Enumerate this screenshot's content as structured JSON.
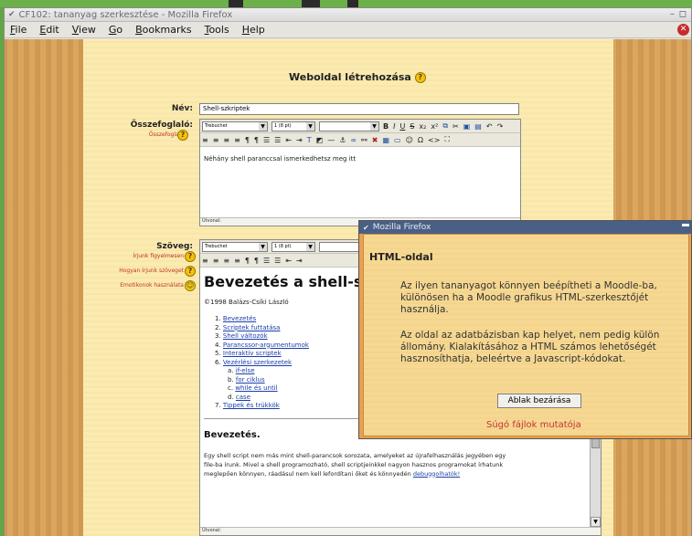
{
  "window": {
    "title": "CF102: tananyag szerkesztése - Mozilla Firefox",
    "menu": [
      "File",
      "Edit",
      "View",
      "Go",
      "Bookmarks",
      "Tools",
      "Help"
    ]
  },
  "form": {
    "title": "Weboldal létrehozása",
    "name_label": "Név:",
    "name_value": "Shell-szkriptek",
    "summary_label": "Összefoglaló:",
    "summary_help_link": "Összefoglaló",
    "summary_text": "Néhány shell paranccsal ismerkedhetsz meg itt",
    "path_label": "Útvonal:",
    "content_label": "Szöveg:",
    "content_links": [
      "Írjunk figyelmesen",
      "Hogyan írjunk szöveget",
      "Emotikonok használata"
    ]
  },
  "toolbar": {
    "font": "Trebuchet",
    "size": "1 (8 pt)",
    "style": ""
  },
  "doc": {
    "heading": "Bevezetés a shell-sc",
    "author": "©1998 Balázs-Csíki László",
    "toc": [
      {
        "n": "1.",
        "t": "Bevezetés"
      },
      {
        "n": "2.",
        "t": "Scriptek futtatása"
      },
      {
        "n": "3.",
        "t": "Shell változók"
      },
      {
        "n": "4.",
        "t": "Parancssor-argumentumok"
      },
      {
        "n": "5.",
        "t": "Interaktív scriptek"
      },
      {
        "n": "6.",
        "t": "Vezérlési szerkezetek"
      },
      {
        "n": "a.",
        "t": "if-else"
      },
      {
        "n": "b.",
        "t": "for ciklus"
      },
      {
        "n": "c.",
        "t": "while és until"
      },
      {
        "n": "d.",
        "t": "case"
      },
      {
        "n": "7.",
        "t": "Tippek és trükkök"
      }
    ],
    "section": "Bevezetés.",
    "para_1": "Egy shell script nem más mint shell-parancsok sorozata, amelyeket az újrafelhasználás jegyében egy",
    "para_2": "file-ba írunk. Mivel a shell programozható, shell scriptjeinkkel nagyon hasznos programokat írhatunk",
    "para_3": "meglepően könnyen, ráadásul nem kell lefordítani őket és könnyedén ",
    "para_link": "debuggolhatók!"
  },
  "popup": {
    "title": "Mozilla Firefox",
    "heading": "HTML-oldal",
    "p1_l1": "Az ilyen tananyagot könnyen beépítheti a Moodle-ba,",
    "p1_l2": "különösen ha a Moodle grafikus HTML-szerkesztőjét",
    "p1_l3": "használja.",
    "p2_l1": "Az oldal az adatbázisban kap helyet, nem pedig külön",
    "p2_l2": "állomány. Kialakításához a HTML számos lehetőségét",
    "p2_l3": "hasznosíthatja, beleértve a Javascript-kódokat.",
    "close_button": "Ablak bezárása",
    "help_files_link": "Súgó fájlok mutatója"
  },
  "colors": {
    "desktop": "#62a544",
    "page_bg": "#fbebb0",
    "wood": "#d9a25a",
    "link": "#1a3ea8",
    "red_link": "#c0322a",
    "popup_title": "#4a5f86"
  }
}
